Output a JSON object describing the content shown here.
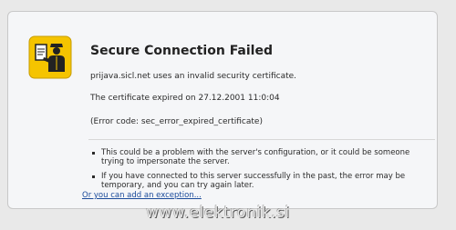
{
  "error": {
    "title": "Secure Connection Failed",
    "line1": "prijava.sicl.net uses an invalid security certificate.",
    "line2": "The certificate expired on 27.12.2001 11:0:04",
    "line3": "(Error code: sec_error_expired_certificate)",
    "bullets": [
      "This could be a problem with the server's configuration, or it could be someone trying to impersonate the server.",
      "If you have connected to this server successfully in the past, the error may be temporary, and you can try again later."
    ],
    "exception_link": "Or you can add an exception...",
    "icon": "security-officer-icon"
  },
  "watermark": "www.elektronik.si",
  "colors": {
    "icon_yellow": "#f5c400",
    "link": "#1a4a9a"
  }
}
